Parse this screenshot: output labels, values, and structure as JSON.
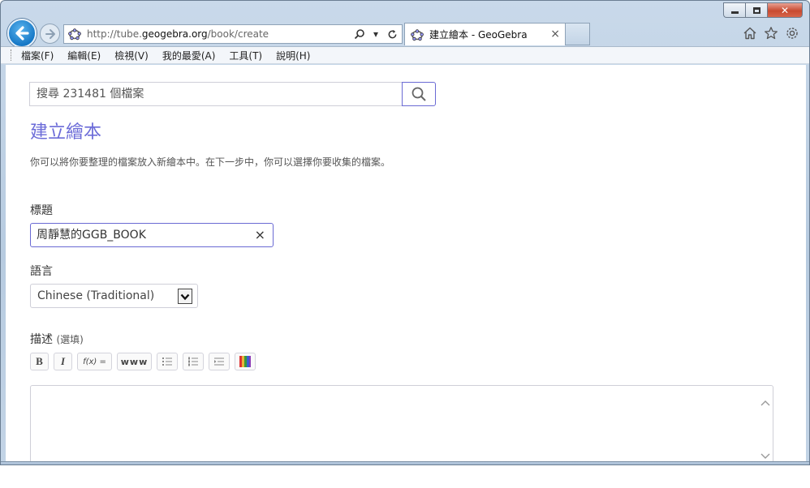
{
  "window": {
    "controls": {
      "minimize": "minimize",
      "maximize": "maximize",
      "close": "close"
    }
  },
  "nav": {
    "address": {
      "prefix": "http://tube.",
      "domain": "geogebra.org",
      "suffix": "/book/create"
    },
    "tab_title": "建立繪本 - GeoGebra",
    "tab_close": "×"
  },
  "menu": {
    "items": [
      "檔案(F)",
      "編輯(E)",
      "檢視(V)",
      "我的最愛(A)",
      "工具(T)",
      "說明(H)"
    ]
  },
  "page": {
    "search_placeholder": "搜尋 231481 個檔案",
    "title": "建立繪本",
    "intro": "你可以將你要整理的檔案放入新繪本中。在下一步中，你可以選擇你要收集的檔案。",
    "title_label": "標題",
    "title_value": "周靜慧的GGB_BOOK",
    "clear": "×",
    "language_label": "語言",
    "language_value": "Chinese (Traditional)",
    "description_label": "描述",
    "description_optional": "(選填)",
    "toolbar": {
      "bold": "B",
      "italic": "I",
      "formula": "f(x) =",
      "link": "www"
    }
  },
  "colors": {
    "accent": "#6b6bd8",
    "focus_border": "#6a6ad4",
    "back_button": "#1678c6"
  }
}
